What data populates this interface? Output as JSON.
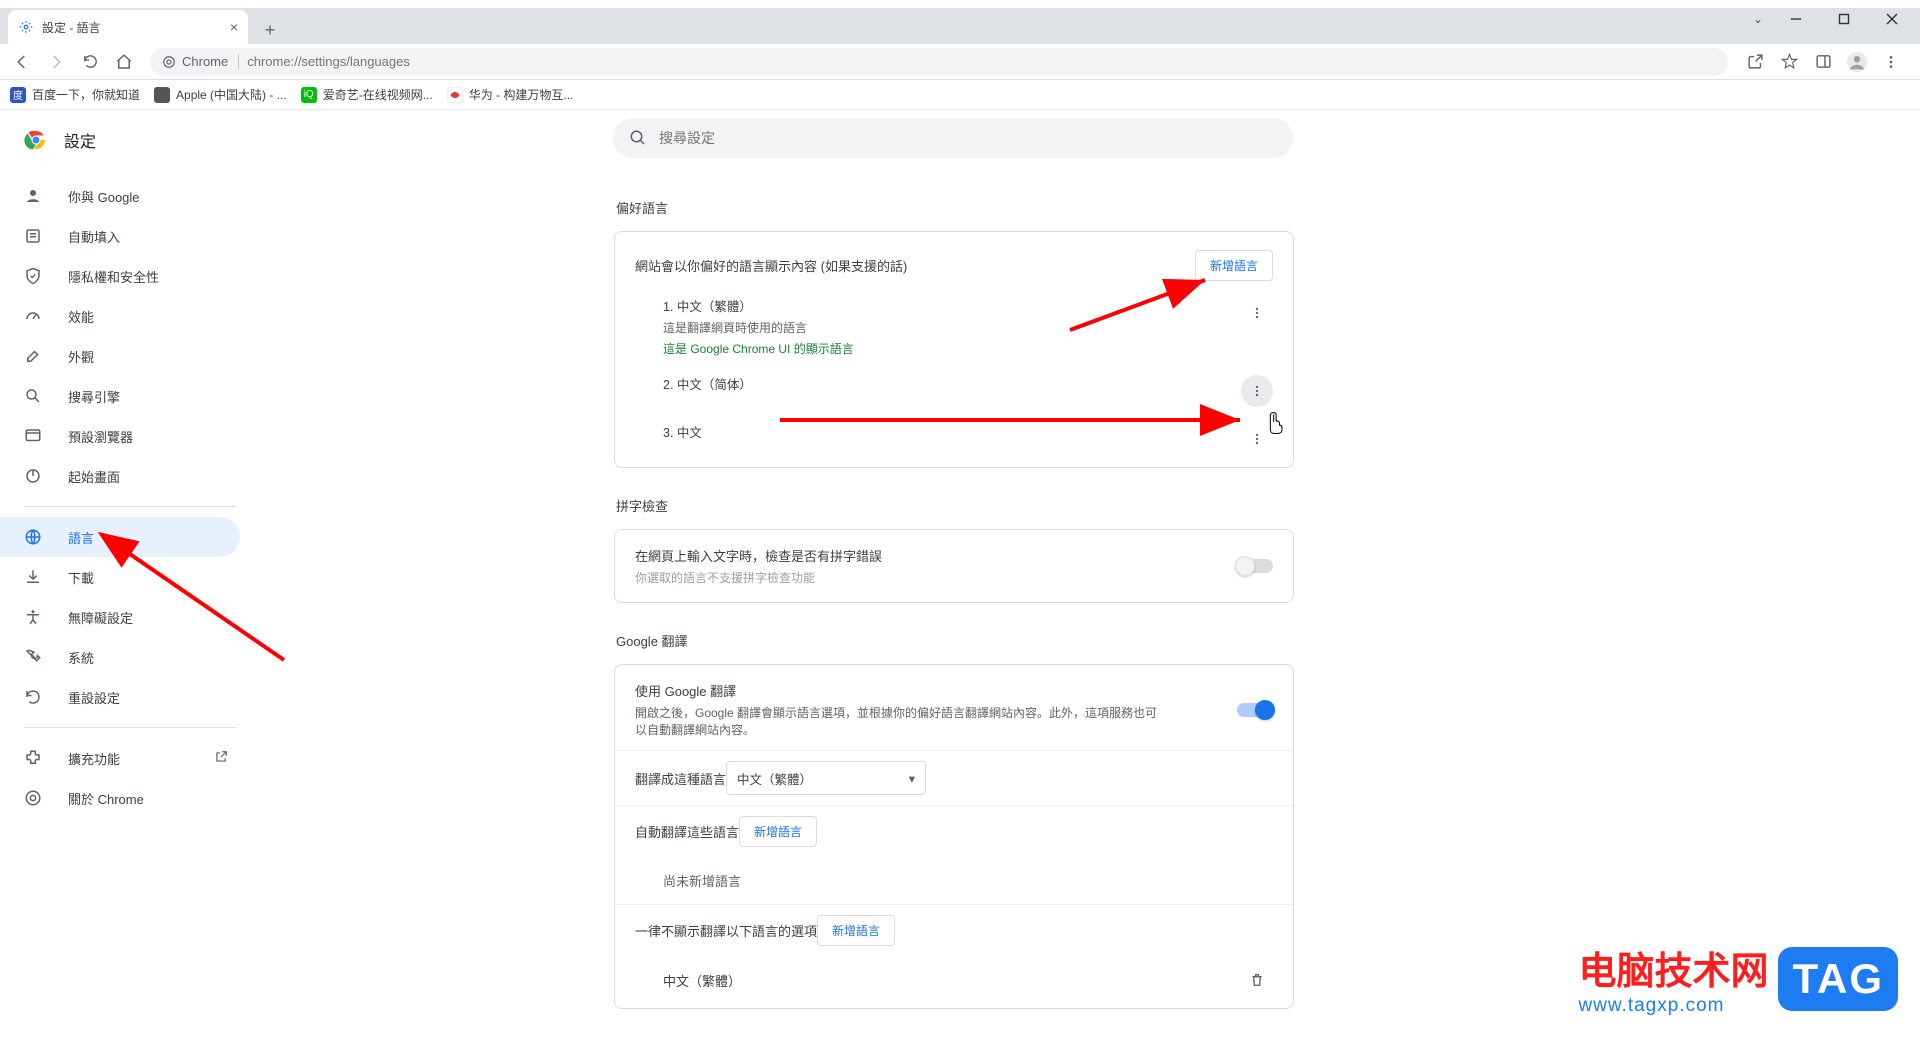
{
  "window": {
    "tab_title": "設定 - 語言"
  },
  "omnibox": {
    "chip": "Chrome",
    "url": "chrome://settings/languages"
  },
  "bookmarks": [
    {
      "label": "百度一下，你就知道",
      "color": "#2a56c6"
    },
    {
      "label": "Apple (中国大陆) - ...",
      "color": "#555"
    },
    {
      "label": "爱奇艺-在线视频网...",
      "color": "#00be06"
    },
    {
      "label": "华为 - 构建万物互...",
      "color": "#e53935"
    }
  ],
  "settings_title": "設定",
  "search": {
    "placeholder": "搜尋設定"
  },
  "sidebar": {
    "items": [
      {
        "label": "你與 Google",
        "icon": "person"
      },
      {
        "label": "自動填入",
        "icon": "autofill"
      },
      {
        "label": "隱私權和安全性",
        "icon": "shield"
      },
      {
        "label": "效能",
        "icon": "speed"
      },
      {
        "label": "外觀",
        "icon": "brush"
      },
      {
        "label": "搜尋引擎",
        "icon": "search"
      },
      {
        "label": "預設瀏覽器",
        "icon": "browser"
      },
      {
        "label": "起始畫面",
        "icon": "power"
      }
    ],
    "items2": [
      {
        "label": "語言",
        "icon": "globe",
        "active": true
      },
      {
        "label": "下載",
        "icon": "download"
      },
      {
        "label": "無障礙設定",
        "icon": "a11y"
      },
      {
        "label": "系統",
        "icon": "wrench"
      },
      {
        "label": "重設設定",
        "icon": "reset"
      }
    ],
    "items3": [
      {
        "label": "擴充功能",
        "icon": "ext",
        "external": true
      },
      {
        "label": "關於 Chrome",
        "icon": "chrome"
      }
    ]
  },
  "sections": {
    "pref_lang": {
      "title": "偏好語言",
      "desc": "網站會以你偏好的語言顯示內容 (如果支援的話)",
      "add": "新增語言",
      "items": [
        {
          "rank": "1.",
          "name": "中文（繁體）",
          "sub": "這是翻譯網頁時使用的語言",
          "green": "這是 Google Chrome UI 的顯示語言"
        },
        {
          "rank": "2.",
          "name": "中文（简体）"
        },
        {
          "rank": "3.",
          "name": "中文"
        }
      ]
    },
    "spell": {
      "title": "拼字檢查",
      "row_t": "在網頁上輸入文字時，檢查是否有拼字錯誤",
      "row_s": "你選取的語言不支援拼字檢查功能"
    },
    "translate": {
      "title": "Google 翻譯",
      "use_t": "使用 Google 翻譯",
      "use_s": "開啟之後，Google 翻譯會顯示語言選項，並根據你的偏好語言翻譯網站內容。此外，這項服務也可以自動翻譯網站內容。",
      "into_label": "翻譯成這種語言",
      "into_value": "中文（繁體）",
      "auto_label": "自動翻譯這些語言",
      "auto_add": "新增語言",
      "auto_empty": "尚未新增語言",
      "never_label": "一律不顯示翻譯以下語言的選項",
      "never_add": "新增語言",
      "never_item": "中文（繁體）"
    }
  },
  "watermark": {
    "line1": "电脑技术网",
    "line2": "www.tagxp.com",
    "tag": "TAG"
  }
}
